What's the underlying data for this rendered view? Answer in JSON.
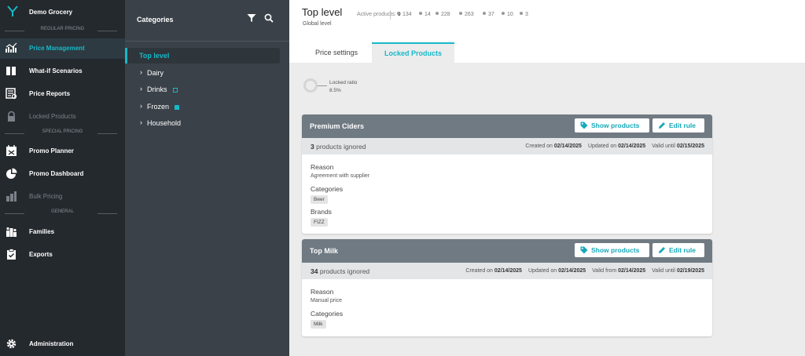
{
  "brand": {
    "name": "Demo Grocery"
  },
  "nav": {
    "sections": {
      "regular": "REGULAR PRICING",
      "special": "SPECIAL PRICING",
      "general": "GENERAL"
    },
    "items": [
      {
        "label": "Price Management",
        "icon": "chart-icon"
      },
      {
        "label": "What-if Scenarios",
        "icon": "book-icon"
      },
      {
        "label": "Price Reports",
        "icon": "report-icon"
      },
      {
        "label": "Locked Products",
        "icon": "lock-icon"
      },
      {
        "label": "Promo Planner",
        "icon": "calendar-icon"
      },
      {
        "label": "Promo Dashboard",
        "icon": "pie-icon"
      },
      {
        "label": "Bulk Pricing",
        "icon": "bulk-icon"
      },
      {
        "label": "Families",
        "icon": "families-icon"
      },
      {
        "label": "Exports",
        "icon": "clipboard-check-icon"
      },
      {
        "label": "Administration",
        "icon": "gear-icon"
      }
    ]
  },
  "categories": {
    "title": "Categories",
    "items": [
      {
        "label": "Top level"
      },
      {
        "label": "Dairy"
      },
      {
        "label": "Drinks"
      },
      {
        "label": "Frozen"
      },
      {
        "label": "Household"
      }
    ]
  },
  "header": {
    "title": "Top level",
    "subtitle": "Global level",
    "active_label": "Active products:",
    "active_count": "0",
    "stats": [
      "134",
      "14",
      "228",
      "263",
      "37",
      "10",
      "3"
    ]
  },
  "tabs": {
    "settings": "Price settings",
    "locked": "Locked Products"
  },
  "ratio": {
    "label": "Locked ratio",
    "value": "8.5%"
  },
  "buttons": {
    "show": "Show products",
    "edit": "Edit rule"
  },
  "cards": [
    {
      "title": "Premium Ciders",
      "count": "3",
      "count_suffix": "products ignored",
      "created_label": "Created on",
      "created": "02/14/2025",
      "updated_label": "Updated on",
      "updated": "02/14/2025",
      "valid_until_label": "Valid until",
      "valid_until": "02/15/2025",
      "reason_label": "Reason",
      "reason": "Agreement with supplier",
      "categories_label": "Categories",
      "category": "Beer",
      "brands_label": "Brands",
      "brand": "FIZZ"
    },
    {
      "title": "Top Milk",
      "count": "34",
      "count_suffix": "products ignored",
      "created_label": "Created on",
      "created": "02/14/2025",
      "updated_label": "Updated on",
      "updated": "02/14/2025",
      "valid_from_label": "Valid from",
      "valid_from": "02/14/2025",
      "valid_until_label": "Valid until",
      "valid_until": "02/19/2025",
      "reason_label": "Reason",
      "reason": "Manual price",
      "categories_label": "Categories",
      "category": "Milk"
    }
  ],
  "colors": {
    "accent": "#17b8c8",
    "nav_bg": "#24292e",
    "panel_bg": "#3a4148",
    "card_header": "#707a83"
  }
}
